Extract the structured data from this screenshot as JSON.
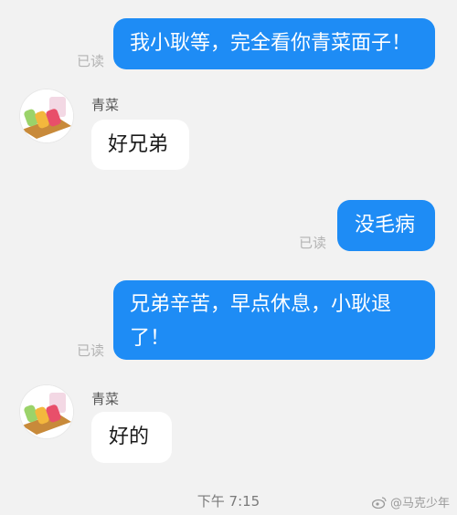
{
  "conversation": {
    "contact_name": "青菜",
    "messages": [
      {
        "side": "out",
        "text": "我小耿等，完全看你青菜面子！",
        "status": "已读"
      },
      {
        "side": "in",
        "sender": "青菜",
        "text": "好兄弟"
      },
      {
        "side": "out",
        "text": "没毛病",
        "status": "已读"
      },
      {
        "side": "out",
        "text_line1": "兄弟辛苦，早点休息，小耿退",
        "text_line2": "了！",
        "status": "已读"
      },
      {
        "side": "in",
        "sender": "青菜",
        "text": "好的"
      }
    ]
  },
  "footer": {
    "timestamp": "下午 7:15",
    "watermark": "@马克少年"
  },
  "colors": {
    "outgoing_bubble": "#1e8cf5",
    "incoming_bubble": "#ffffff",
    "background": "#f2f2f2",
    "read_status": "#b3b3b3"
  },
  "icons": {
    "avatar": "avatar-icon",
    "watermark": "weibo-logo-icon"
  }
}
